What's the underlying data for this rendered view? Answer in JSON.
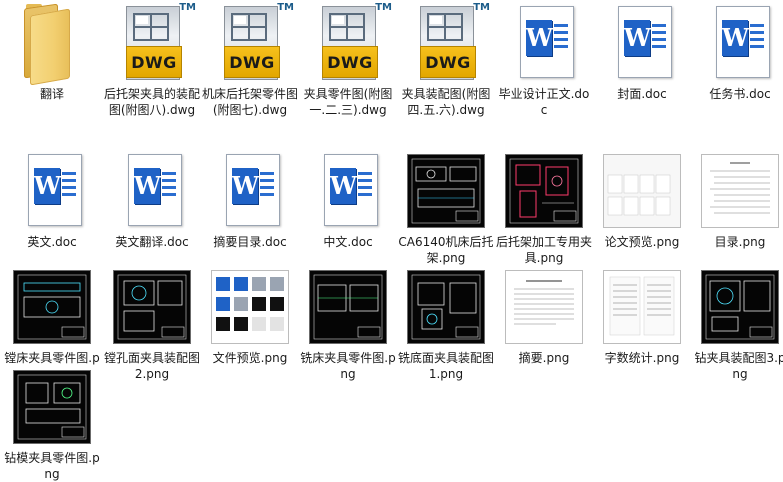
{
  "files": [
    {
      "id": "translate-folder",
      "kind": "folder",
      "label": "翻译"
    },
    {
      "id": "dwg-1",
      "kind": "dwg",
      "label": "后托架夹具的装配图(附图八).dwg"
    },
    {
      "id": "dwg-2",
      "kind": "dwg",
      "label": "机床后托架零件图(附图七).dwg"
    },
    {
      "id": "dwg-3",
      "kind": "dwg",
      "label": "夹具零件图(附图一.二.三).dwg"
    },
    {
      "id": "dwg-4",
      "kind": "dwg",
      "label": "夹具装配图(附图四.五.六).dwg"
    },
    {
      "id": "doc-1",
      "kind": "doc",
      "label": "毕业设计正文.doc"
    },
    {
      "id": "doc-2",
      "kind": "doc",
      "label": "封面.doc"
    },
    {
      "id": "doc-3",
      "kind": "doc",
      "label": "任务书.doc"
    },
    {
      "id": "doc-4",
      "kind": "doc",
      "label": "英文.doc"
    },
    {
      "id": "doc-5",
      "kind": "doc",
      "label": "英文翻译.doc"
    },
    {
      "id": "doc-6",
      "kind": "doc",
      "label": "摘要目录.doc"
    },
    {
      "id": "doc-7",
      "kind": "doc",
      "label": "中文.doc"
    },
    {
      "id": "png-1",
      "kind": "png-cad",
      "label": "CA6140机床后托架.png"
    },
    {
      "id": "png-2",
      "kind": "png-cad-red",
      "label": "后托架加工专用夹具.png"
    },
    {
      "id": "png-3",
      "kind": "png-paper",
      "label": "论文预览.png"
    },
    {
      "id": "png-4",
      "kind": "png-paper-toc",
      "label": "目录.png"
    },
    {
      "id": "png-5",
      "kind": "png-cad",
      "label": "镗床夹具零件图.png"
    },
    {
      "id": "png-6",
      "kind": "png-cad",
      "label": "镗孔面夹具装配图2.png"
    },
    {
      "id": "png-7",
      "kind": "png-preview",
      "label": "文件预览.png"
    },
    {
      "id": "png-8",
      "kind": "png-cad",
      "label": "铣床夹具零件图.png"
    },
    {
      "id": "png-9",
      "kind": "png-cad",
      "label": "铣底面夹具装配图1.png"
    },
    {
      "id": "png-10",
      "kind": "png-paper-text",
      "label": "摘要.png"
    },
    {
      "id": "png-11",
      "kind": "png-paper-text",
      "label": "字数统计.png"
    },
    {
      "id": "png-12",
      "kind": "png-cad",
      "label": "钻夹具装配图3.png"
    },
    {
      "id": "png-13",
      "kind": "png-cad",
      "label": "钻模夹具零件图.png"
    }
  ],
  "dwg_badge": "DWG",
  "dwg_tm": "TM",
  "word_letter": "W",
  "colors": {
    "folder": "#f2cf70",
    "dwg_band": "#f6c01c",
    "word_blue": "#1f62c6",
    "cad_background": "#050505"
  }
}
